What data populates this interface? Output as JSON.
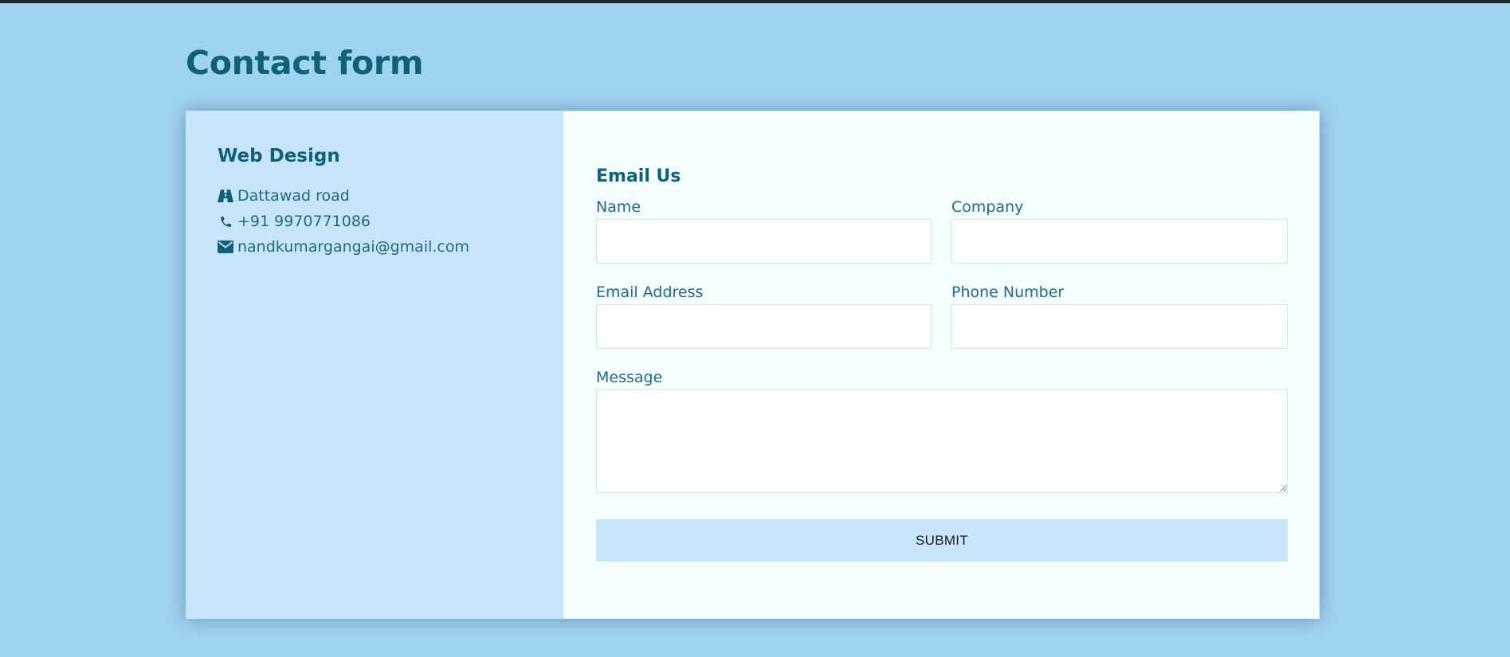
{
  "page": {
    "title": "Contact form"
  },
  "info": {
    "company": "Web Design",
    "items": [
      {
        "icon": "road-icon",
        "text": "Dattawad road"
      },
      {
        "icon": "phone-icon",
        "text": "+91 9970771086"
      },
      {
        "icon": "envelope-icon",
        "text": "nandkumargangai@gmail.com"
      }
    ]
  },
  "form": {
    "title": "Email Us",
    "name": {
      "label": "Name",
      "value": ""
    },
    "company": {
      "label": "Company",
      "value": ""
    },
    "email": {
      "label": "Email Address",
      "value": ""
    },
    "phone": {
      "label": "Phone Number",
      "value": ""
    },
    "message": {
      "label": "Message",
      "value": ""
    },
    "submit_label": "SUBMIT"
  },
  "colors": {
    "background": "#a0d2f1",
    "accent_text": "#0f6178",
    "info_panel": "#c7e5fb",
    "form_panel": "#f6fdff"
  }
}
